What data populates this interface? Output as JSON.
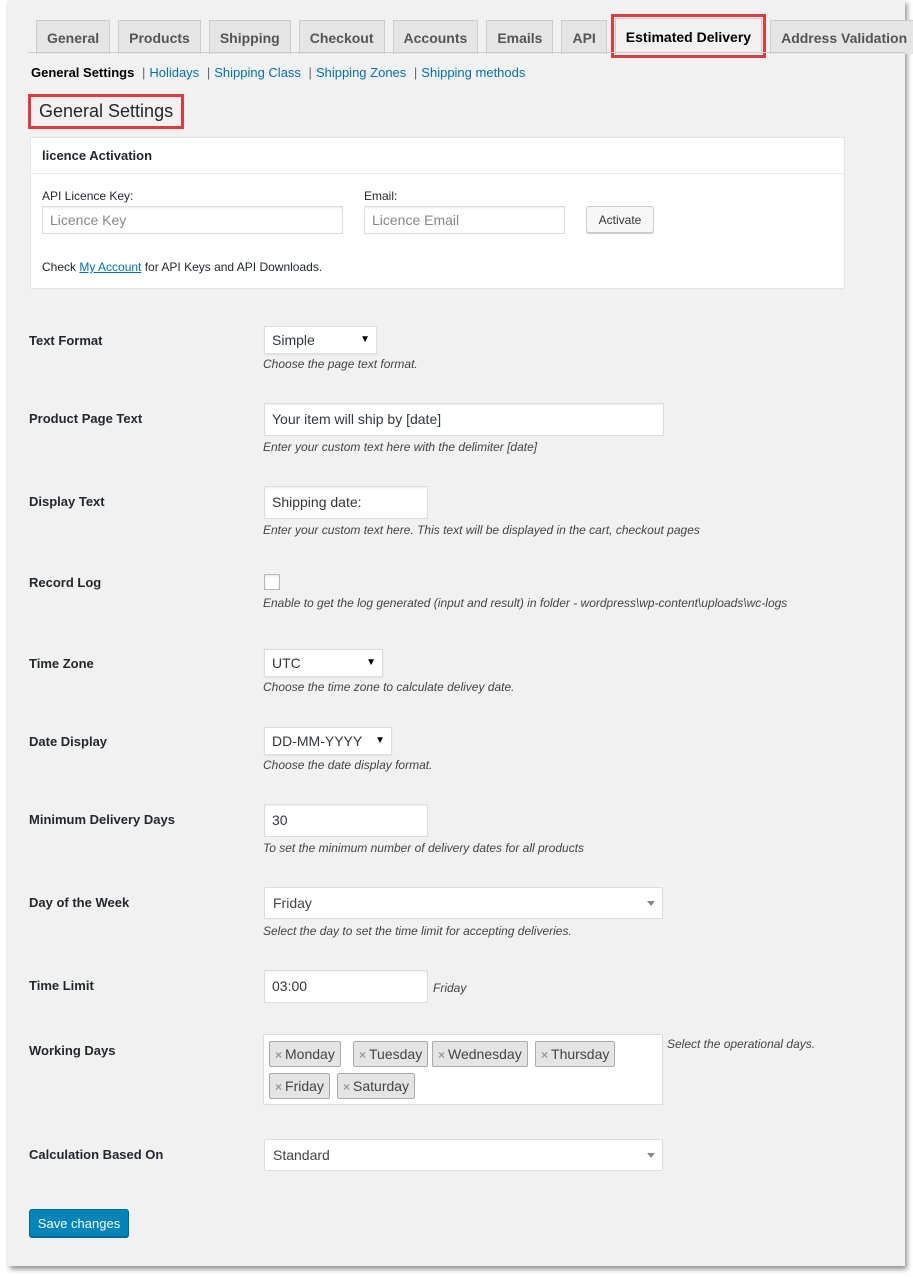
{
  "tabs": [
    {
      "label": "General"
    },
    {
      "label": "Products"
    },
    {
      "label": "Shipping"
    },
    {
      "label": "Checkout"
    },
    {
      "label": "Accounts"
    },
    {
      "label": "Emails"
    },
    {
      "label": "API"
    },
    {
      "label": "Estimated Delivery"
    },
    {
      "label": "Address Validation"
    }
  ],
  "subnav": {
    "current": "General Settings",
    "links": [
      "Holidays",
      "Shipping Class",
      "Shipping Zones",
      "Shipping methods"
    ],
    "separator": "|"
  },
  "heading": "General Settings",
  "licence": {
    "title": "licence Activation",
    "api_key_label": "API Licence Key:",
    "api_key_placeholder": "Licence Key",
    "email_label": "Email:",
    "email_placeholder": "Licence Email",
    "activate_label": "Activate",
    "note_prefix": "Check ",
    "note_link": "My Account",
    "note_suffix": " for API Keys and API Downloads."
  },
  "fields": {
    "text_format": {
      "label": "Text Format",
      "value": "Simple",
      "desc": "Choose the page text format."
    },
    "product_page_text": {
      "label": "Product Page Text",
      "value": "Your item will ship by [date]",
      "desc": "Enter your custom text here with the delimiter [date]"
    },
    "display_text": {
      "label": "Display Text",
      "value": "Shipping date:",
      "desc": "Enter your custom text here. This text will be displayed in the cart, checkout pages"
    },
    "record_log": {
      "label": "Record Log",
      "desc": "Enable to get the log generated (input and result) in folder - wordpress\\wp-content\\uploads\\wc-logs"
    },
    "time_zone": {
      "label": "Time Zone",
      "value": "UTC",
      "desc": "Choose the time zone to calculate delivey date."
    },
    "date_display": {
      "label": "Date Display",
      "value": "DD-MM-YYYY",
      "desc": "Choose the date display format."
    },
    "min_delivery_days": {
      "label": "Minimum Delivery Days",
      "value": "30",
      "desc": "To set the minimum number of delivery dates for all products"
    },
    "day_of_week": {
      "label": "Day of the Week",
      "value": "Friday",
      "desc": "Select the day to set the time limit for accepting deliveries."
    },
    "time_limit": {
      "label": "Time Limit",
      "value": "03:00",
      "suffix": "Friday"
    },
    "working_days": {
      "label": "Working Days",
      "values": [
        "Monday",
        "Tuesday",
        "Wednesday",
        "Thursday",
        "Friday",
        "Saturday"
      ],
      "desc": "Select the operational days.",
      "remove_glyph": "×"
    },
    "calculation_based_on": {
      "label": "Calculation Based On",
      "value": "Standard"
    }
  },
  "save_label": "Save changes",
  "glyphs": {
    "dropdown": "▼"
  },
  "colors": {
    "highlight": "#e0393e",
    "primary": "#0085ba",
    "link": "#0073aa"
  }
}
